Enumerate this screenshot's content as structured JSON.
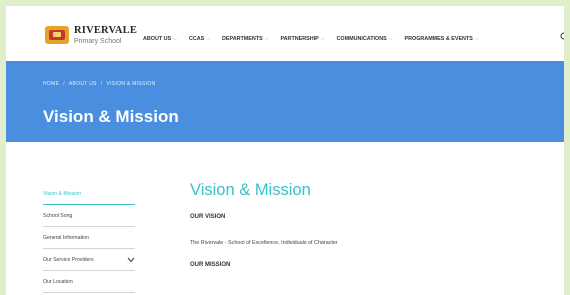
{
  "brand": {
    "name": "RIVERVALE",
    "sub": "Primary School"
  },
  "nav": [
    {
      "label": "ABOUT US"
    },
    {
      "label": "CCAS"
    },
    {
      "label": "DEPARTMENTS"
    },
    {
      "label": "PARTNERSHIP"
    },
    {
      "label": "COMMUNICATIONS"
    },
    {
      "label": "PROGRAMMES & EVENTS"
    }
  ],
  "breadcrumb": {
    "home": "HOME",
    "sep": "/",
    "about": "ABOUT US",
    "current": "VISION & MISSION"
  },
  "banner": {
    "title": "Vision & Mission"
  },
  "sidebar": [
    {
      "label": "Vision & Mission"
    },
    {
      "label": "School Song"
    },
    {
      "label": "General Information"
    },
    {
      "label": "Our Service Providers"
    },
    {
      "label": "Our Location"
    }
  ],
  "content": {
    "title": "Vision & Mission",
    "vision_heading": "OUR VISION",
    "vision_text": "The Rivervale - School of Excellence, Individuals of Character",
    "mission_heading": "OUR MISSION"
  },
  "colors": {
    "accent": "#3ac1c5",
    "banner": "#4a8ee0",
    "page_bg": "#dfeecb"
  },
  "icons": {
    "search": "search-icon",
    "chevron": "chevron-down-icon"
  }
}
